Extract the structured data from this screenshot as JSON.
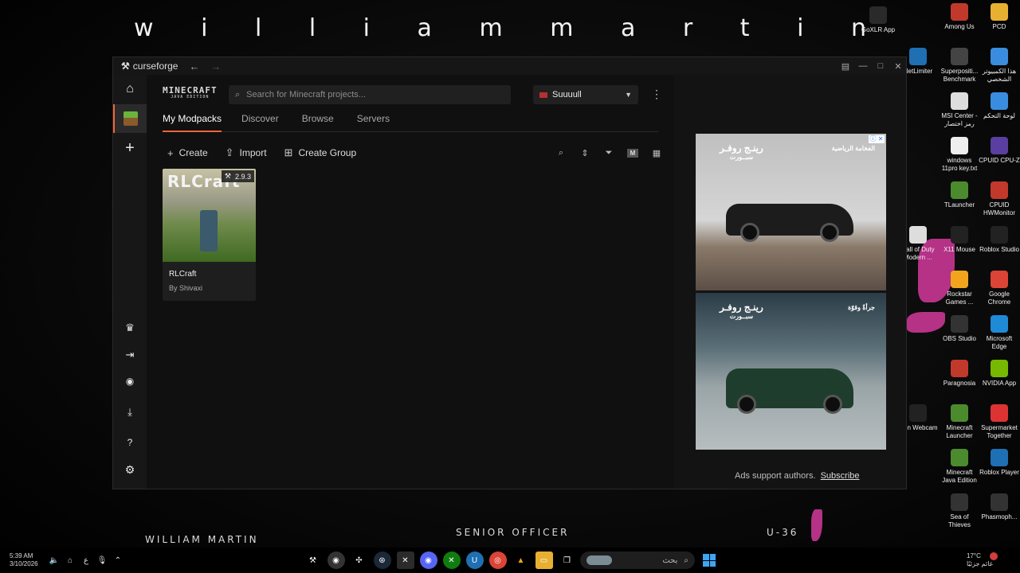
{
  "wallpaper": {
    "title": "w  i  l  l  i  a  m     m  a  r  t  i  n",
    "left_caption": "WILLIAM MARTIN",
    "mid_caption": "SENIOR OFFICER",
    "right_caption": "U-36"
  },
  "desktop_icons": [
    {
      "label": "GoXLR App",
      "icon": "goxlr-icon"
    },
    {
      "label": "Among Us",
      "icon": "among-us-icon"
    },
    {
      "label": "PCD",
      "icon": "folder-icon"
    },
    {
      "label": "NetLimiter",
      "icon": "netlimiter-icon"
    },
    {
      "label": "Superpositi... Benchmark",
      "icon": "superposition-icon"
    },
    {
      "label": "هذا الكمبيوتر الشخصي",
      "icon": "this-pc-icon"
    },
    {
      "label": "MSI Center - رمز اختصار",
      "icon": "file-icon"
    },
    {
      "label": "لوحة التحكم",
      "icon": "control-panel-icon"
    },
    {
      "label": "windows 11pro key.txt",
      "icon": "text-file-icon"
    },
    {
      "label": "CPUID CPU-Z",
      "icon": "cpu-z-icon"
    },
    {
      "label": "TLauncher",
      "icon": "tlauncher-icon"
    },
    {
      "label": "CPUID HWMonitor",
      "icon": "hwmonitor-icon"
    },
    {
      "label": "Call of Duty Modern ...",
      "icon": "file-icon"
    },
    {
      "label": "X11 Mouse",
      "icon": "mouse-icon"
    },
    {
      "label": "Roblox Studio",
      "icon": "roblox-studio-icon"
    },
    {
      "label": "Rockstar Games ...",
      "icon": "rockstar-icon"
    },
    {
      "label": "Google Chrome",
      "icon": "chrome-icon"
    },
    {
      "label": "OBS Studio",
      "icon": "obs-icon"
    },
    {
      "label": "Microsoft Edge",
      "icon": "edge-icon"
    },
    {
      "label": "Paragnosia",
      "icon": "paragnosia-icon"
    },
    {
      "label": "NVIDIA App",
      "icon": "nvidia-icon"
    },
    {
      "label": "Iriun Webcam",
      "icon": "webcam-icon"
    },
    {
      "label": "Minecraft Launcher",
      "icon": "minecraft-icon"
    },
    {
      "label": "Supermarket Together",
      "icon": "supermarket-icon"
    },
    {
      "label": "Minecraft Java Edition",
      "icon": "minecraft-icon"
    },
    {
      "label": "Roblox Player",
      "icon": "roblox-icon"
    },
    {
      "label": "Sea of Thieves",
      "icon": "sea-of-thieves-icon"
    },
    {
      "label": "Phasmoph...",
      "icon": "phasmophobia-icon"
    }
  ],
  "window": {
    "app_name": "curseforge",
    "back": "←",
    "forward": "→"
  },
  "game_logo": {
    "main": "MINECRAFT",
    "sub": "JAVA EDITION"
  },
  "search": {
    "placeholder": "Search for Minecraft projects..."
  },
  "profile": {
    "name": "Suuuull"
  },
  "tabs": [
    "My Modpacks",
    "Discover",
    "Browse",
    "Servers"
  ],
  "actions": {
    "create": "Create",
    "import": "Import",
    "create_group": "Create Group"
  },
  "sort_filter": {
    "m_label": "M"
  },
  "modpacks": [
    {
      "name": "RLCraft",
      "author": "By Shivaxi",
      "version": "2.9.3",
      "image_text": "RLCraft"
    }
  ],
  "ads": [
    {
      "brand": "رينـج روفـر",
      "brand_sub": "سبــورت",
      "tagline": "الفخامة الرياضية"
    },
    {
      "brand": "رينـج روفـر",
      "brand_sub": "سبــورت",
      "tagline": "جرأةٌ وقوّة"
    }
  ],
  "ad_footer": {
    "text": "Ads support authors.",
    "link": "Subscribe"
  },
  "taskbar": {
    "time": "5:39 AM",
    "date": "3/10/2026",
    "lang": "ع",
    "search_label": "بحث",
    "temperature": "17°C",
    "weather_text": "غائم جزئيًا"
  },
  "colors": {
    "accent": "#f16436",
    "window_bg": "#101010",
    "sidebar_bg": "#171717"
  }
}
